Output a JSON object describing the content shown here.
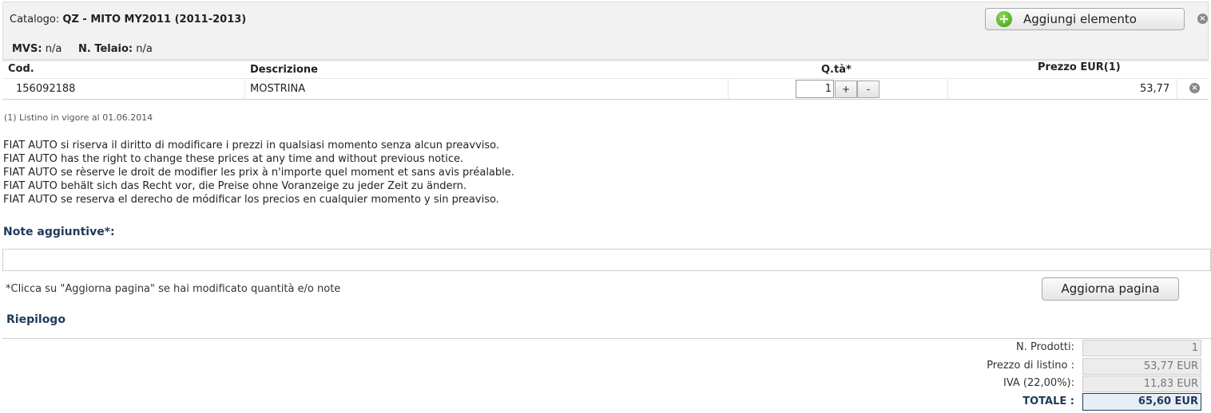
{
  "header": {
    "catalog_label": "Catalogo:",
    "catalog_value": "QZ - MITO MY2011 (2011-2013)",
    "mvs_label": "MVS:",
    "mvs_value": "n/a",
    "chassis_label": "N. Telaio:",
    "chassis_value": "n/a",
    "add_button_label": "Aggiungi elemento"
  },
  "table": {
    "columns": [
      "Cod.",
      "Descrizione",
      "Q.tà*",
      "Prezzo EUR(1)"
    ],
    "rows": [
      {
        "code": "156092188",
        "description": "MOSTRINA",
        "quantity": "1",
        "price": "53,77"
      }
    ],
    "plus_label": "+",
    "minus_label": "-"
  },
  "footnote": "(1) Listino in vigore al 01.06.2014",
  "disclaimer": [
    "FIAT AUTO si riserva il diritto di modificare i prezzi in qualsiasi momento senza alcun preavviso.",
    "FIAT AUTO has the right to change these prices at any time and without previous notice.",
    "FIAT AUTO se rèserve le droit de modifier les prix à n'importe quel moment et sans avis préalable.",
    "FIAT AUTO behält sich das Recht vor, die Preise ohne Voranzeige zu jeder Zeit zu ändern.",
    "FIAT AUTO se reserva el derecho de módificar los precios en cualquier momento y sin preaviso."
  ],
  "notes": {
    "title": "Note aggiuntive*:",
    "value": ""
  },
  "hint": "*Clicca su \"Aggiorna pagina\" se hai modificato quantità e/o note",
  "refresh_button_label": "Aggiorna pagina",
  "summary": {
    "title": "Riepilogo",
    "products_label": "N. Prodotti:",
    "products_value": "1",
    "list_price_label": "Prezzo di listino :",
    "list_price_value": "53,77 EUR",
    "vat_label": "IVA (22,00%):",
    "vat_value": "11,83 EUR",
    "total_label": "TOTALE :",
    "total_value": "65,60 EUR"
  },
  "colors": {
    "accent": "#1f3a5a",
    "header_bg": "#f2f2f2",
    "add_icon": "#3c9a12"
  }
}
